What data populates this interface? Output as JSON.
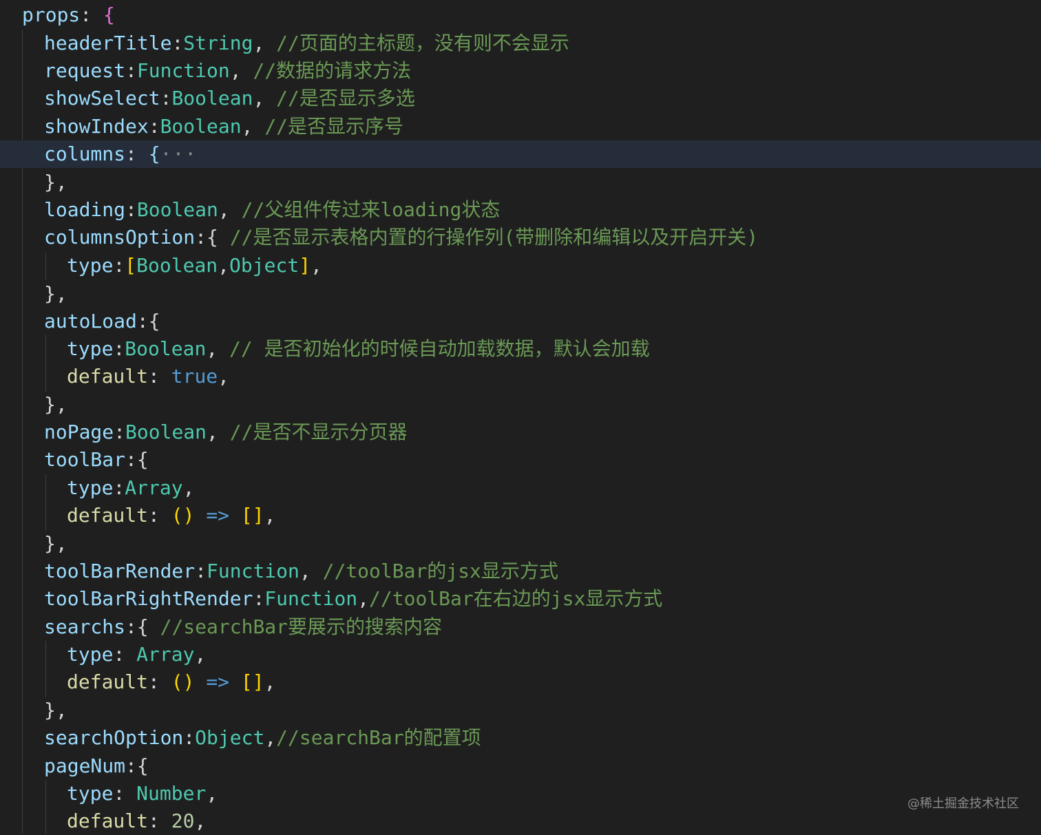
{
  "colors": {
    "background": "#1f1f1f",
    "highlight_line": "#252d3a",
    "property": "#9cdcfe",
    "type": "#4ec9b0",
    "comment": "#6a9955",
    "punctuation": "#d4d4d4",
    "brace_outer": "#da70d6",
    "brace_inner": "#ffd700",
    "keyword_value": "#569cd6",
    "number": "#b5cea8",
    "function_key": "#dcdcaa"
  },
  "lines": [
    {
      "name": "line-props",
      "tokens": [
        {
          "t": "props",
          "c": "property"
        },
        {
          "t": ": ",
          "c": "punctuation"
        },
        {
          "t": "{",
          "c": "brace_outer"
        }
      ]
    },
    {
      "name": "line-headerTitle",
      "tokens": [
        {
          "t": "headerTitle",
          "c": "property"
        },
        {
          "t": ":",
          "c": "punctuation"
        },
        {
          "t": "String",
          "c": "type"
        },
        {
          "t": ", ",
          "c": "punctuation"
        },
        {
          "t": "//页面的主标题，没有则不会显示",
          "c": "comment"
        }
      ]
    },
    {
      "name": "line-request",
      "tokens": [
        {
          "t": "request",
          "c": "property"
        },
        {
          "t": ":",
          "c": "punctuation"
        },
        {
          "t": "Function",
          "c": "type"
        },
        {
          "t": ", ",
          "c": "punctuation"
        },
        {
          "t": "//数据的请求方法",
          "c": "comment"
        }
      ]
    },
    {
      "name": "line-showSelect",
      "tokens": [
        {
          "t": "showSelect",
          "c": "property"
        },
        {
          "t": ":",
          "c": "punctuation"
        },
        {
          "t": "Boolean",
          "c": "type"
        },
        {
          "t": ", ",
          "c": "punctuation"
        },
        {
          "t": "//是否显示多选",
          "c": "comment"
        }
      ]
    },
    {
      "name": "line-showIndex",
      "tokens": [
        {
          "t": "showIndex",
          "c": "property"
        },
        {
          "t": ":",
          "c": "punctuation"
        },
        {
          "t": "Boolean",
          "c": "type"
        },
        {
          "t": ", ",
          "c": "punctuation"
        },
        {
          "t": "//是否显示序号",
          "c": "comment"
        }
      ]
    },
    {
      "name": "line-columns",
      "tokens": [
        {
          "t": "columns",
          "c": "property"
        },
        {
          "t": ": ",
          "c": "punctuation"
        },
        {
          "t": "{",
          "c": "property"
        },
        {
          "t": "···",
          "c": "fold"
        }
      ]
    },
    {
      "name": "line-columns-close",
      "tokens": [
        {
          "t": "},",
          "c": "punctuation"
        }
      ]
    },
    {
      "name": "line-loading",
      "tokens": [
        {
          "t": "loading",
          "c": "property"
        },
        {
          "t": ":",
          "c": "punctuation"
        },
        {
          "t": "Boolean",
          "c": "type"
        },
        {
          "t": ", ",
          "c": "punctuation"
        },
        {
          "t": "//父组件传过来loading状态",
          "c": "comment"
        }
      ]
    },
    {
      "name": "line-columnsOption",
      "tokens": [
        {
          "t": "columnsOption",
          "c": "property"
        },
        {
          "t": ":{ ",
          "c": "punctuation"
        },
        {
          "t": "//是否显示表格内置的行操作列(带删除和编辑以及开启开关)",
          "c": "comment"
        }
      ]
    },
    {
      "name": "line-columnsOption-type",
      "tokens": [
        {
          "t": "type",
          "c": "property"
        },
        {
          "t": ":",
          "c": "punctuation"
        },
        {
          "t": "[",
          "c": "brace_inner"
        },
        {
          "t": "Boolean",
          "c": "type"
        },
        {
          "t": ",",
          "c": "punctuation"
        },
        {
          "t": "Object",
          "c": "type"
        },
        {
          "t": "]",
          "c": "brace_inner"
        },
        {
          "t": ",",
          "c": "punctuation"
        }
      ]
    },
    {
      "name": "line-columnsOption-close",
      "tokens": [
        {
          "t": "},",
          "c": "punctuation"
        }
      ]
    },
    {
      "name": "line-autoLoad",
      "tokens": [
        {
          "t": "autoLoad",
          "c": "property"
        },
        {
          "t": ":{",
          "c": "punctuation"
        }
      ]
    },
    {
      "name": "line-autoLoad-type",
      "tokens": [
        {
          "t": "type",
          "c": "property"
        },
        {
          "t": ":",
          "c": "punctuation"
        },
        {
          "t": "Boolean",
          "c": "type"
        },
        {
          "t": ", ",
          "c": "punctuation"
        },
        {
          "t": "// 是否初始化的时候自动加载数据，默认会加载",
          "c": "comment"
        }
      ]
    },
    {
      "name": "line-autoLoad-default",
      "tokens": [
        {
          "t": "default",
          "c": "function_key"
        },
        {
          "t": ": ",
          "c": "punctuation"
        },
        {
          "t": "true",
          "c": "keyword_value"
        },
        {
          "t": ",",
          "c": "punctuation"
        }
      ]
    },
    {
      "name": "line-autoLoad-close",
      "tokens": [
        {
          "t": "},",
          "c": "punctuation"
        }
      ]
    },
    {
      "name": "line-noPage",
      "tokens": [
        {
          "t": "noPage",
          "c": "property"
        },
        {
          "t": ":",
          "c": "punctuation"
        },
        {
          "t": "Boolean",
          "c": "type"
        },
        {
          "t": ", ",
          "c": "punctuation"
        },
        {
          "t": "//是否不显示分页器",
          "c": "comment"
        }
      ]
    },
    {
      "name": "line-toolBar",
      "tokens": [
        {
          "t": "toolBar",
          "c": "property"
        },
        {
          "t": ":{",
          "c": "punctuation"
        }
      ]
    },
    {
      "name": "line-toolBar-type",
      "tokens": [
        {
          "t": "type",
          "c": "property"
        },
        {
          "t": ":",
          "c": "punctuation"
        },
        {
          "t": "Array",
          "c": "type"
        },
        {
          "t": ",",
          "c": "punctuation"
        }
      ]
    },
    {
      "name": "line-toolBar-default",
      "tokens": [
        {
          "t": "default",
          "c": "function_key"
        },
        {
          "t": ": ",
          "c": "punctuation"
        },
        {
          "t": "()",
          "c": "brace_inner"
        },
        {
          "t": " ",
          "c": "punctuation"
        },
        {
          "t": "=>",
          "c": "keyword_value"
        },
        {
          "t": " ",
          "c": "punctuation"
        },
        {
          "t": "[]",
          "c": "brace_inner"
        },
        {
          "t": ",",
          "c": "punctuation"
        }
      ]
    },
    {
      "name": "line-toolBar-close",
      "tokens": [
        {
          "t": "},",
          "c": "punctuation"
        }
      ]
    },
    {
      "name": "line-toolBarRender",
      "tokens": [
        {
          "t": "toolBarRender",
          "c": "property"
        },
        {
          "t": ":",
          "c": "punctuation"
        },
        {
          "t": "Function",
          "c": "type"
        },
        {
          "t": ", ",
          "c": "punctuation"
        },
        {
          "t": "//toolBar的jsx显示方式",
          "c": "comment"
        }
      ]
    },
    {
      "name": "line-toolBarRightRender",
      "tokens": [
        {
          "t": "toolBarRightRender",
          "c": "property"
        },
        {
          "t": ":",
          "c": "punctuation"
        },
        {
          "t": "Function",
          "c": "type"
        },
        {
          "t": ",",
          "c": "punctuation"
        },
        {
          "t": "//toolBar在右边的jsx显示方式",
          "c": "comment"
        }
      ]
    },
    {
      "name": "line-searchs",
      "tokens": [
        {
          "t": "searchs",
          "c": "property"
        },
        {
          "t": ":{ ",
          "c": "punctuation"
        },
        {
          "t": "//searchBar要展示的搜索内容",
          "c": "comment"
        }
      ]
    },
    {
      "name": "line-searchs-type",
      "tokens": [
        {
          "t": "type",
          "c": "property"
        },
        {
          "t": ": ",
          "c": "punctuation"
        },
        {
          "t": "Array",
          "c": "type"
        },
        {
          "t": ",",
          "c": "punctuation"
        }
      ]
    },
    {
      "name": "line-searchs-default",
      "tokens": [
        {
          "t": "default",
          "c": "function_key"
        },
        {
          "t": ": ",
          "c": "punctuation"
        },
        {
          "t": "()",
          "c": "brace_inner"
        },
        {
          "t": " ",
          "c": "punctuation"
        },
        {
          "t": "=>",
          "c": "keyword_value"
        },
        {
          "t": " ",
          "c": "punctuation"
        },
        {
          "t": "[]",
          "c": "brace_inner"
        },
        {
          "t": ",",
          "c": "punctuation"
        }
      ]
    },
    {
      "name": "line-searchs-close",
      "tokens": [
        {
          "t": "},",
          "c": "punctuation"
        }
      ]
    },
    {
      "name": "line-searchOption",
      "tokens": [
        {
          "t": "searchOption",
          "c": "property"
        },
        {
          "t": ":",
          "c": "punctuation"
        },
        {
          "t": "Object",
          "c": "type"
        },
        {
          "t": ",",
          "c": "punctuation"
        },
        {
          "t": "//searchBar的配置项",
          "c": "comment"
        }
      ]
    },
    {
      "name": "line-pageNum",
      "tokens": [
        {
          "t": "pageNum",
          "c": "property"
        },
        {
          "t": ":{",
          "c": "punctuation"
        }
      ]
    },
    {
      "name": "line-pageNum-type",
      "tokens": [
        {
          "t": "type",
          "c": "property"
        },
        {
          "t": ": ",
          "c": "punctuation"
        },
        {
          "t": "Number",
          "c": "type"
        },
        {
          "t": ",",
          "c": "punctuation"
        }
      ]
    },
    {
      "name": "line-pageNum-default",
      "tokens": [
        {
          "t": "default",
          "c": "function_key"
        },
        {
          "t": ": ",
          "c": "punctuation"
        },
        {
          "t": "20",
          "c": "number"
        },
        {
          "t": ",",
          "c": "punctuation"
        }
      ]
    }
  ],
  "watermark": "@稀土掘金技术社区"
}
